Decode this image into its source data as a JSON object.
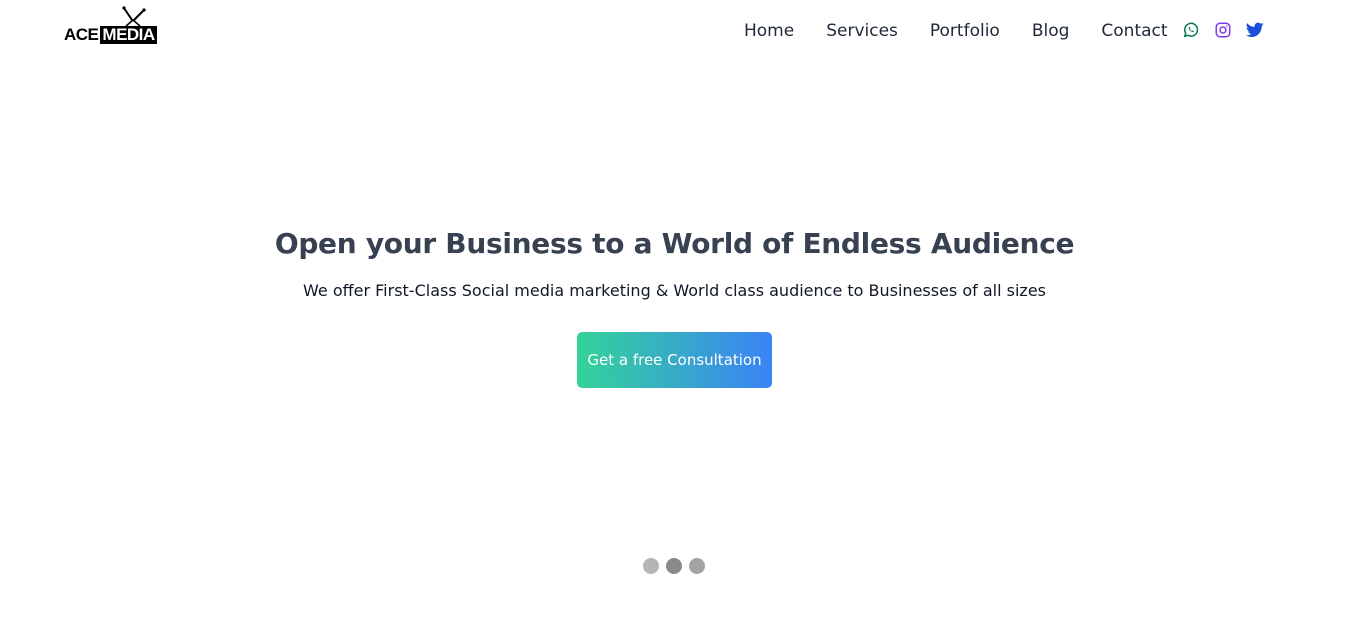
{
  "brand": {
    "logo_part1": "ACE",
    "logo_part2": "MEDIA"
  },
  "nav": {
    "items": [
      {
        "label": "Home"
      },
      {
        "label": "Services"
      },
      {
        "label": "Portfolio"
      },
      {
        "label": "Blog"
      },
      {
        "label": "Contact"
      }
    ]
  },
  "socials": [
    {
      "icon": "whatsapp-icon",
      "color": "#047857"
    },
    {
      "icon": "instagram-icon",
      "color": "#7c3aed"
    },
    {
      "icon": "twitter-icon",
      "color": "#1d4ed8"
    }
  ],
  "hero": {
    "title": "Open your Business to a World of Endless Audience",
    "subtitle": "We offer First-Class Social media marketing & World class audience to Businesses of all sizes",
    "cta_label": "Get a free Consultation",
    "gradient_start": "#34d399",
    "gradient_end": "#3b82f6"
  },
  "carousel": {
    "slide_count": 3,
    "active_index": 1
  }
}
